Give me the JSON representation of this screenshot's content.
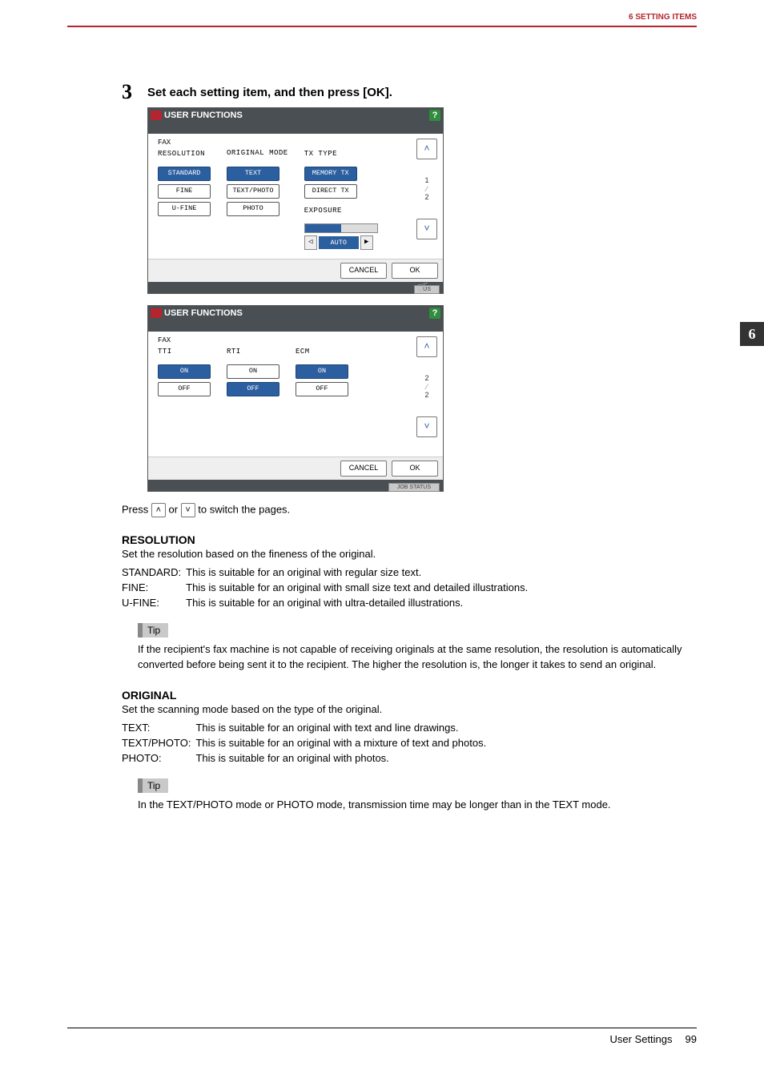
{
  "header": {
    "section": "6 SETTING ITEMS"
  },
  "side_tab": "6",
  "step": {
    "number": "3",
    "text": "Set each setting item, and then press [OK]."
  },
  "panel_title": "USER FUNCTIONS",
  "fax_label": "FAX",
  "screen1": {
    "col1": {
      "title": "RESOLUTION",
      "options": [
        "STANDARD",
        "FINE",
        "U-FINE"
      ],
      "selected": 0
    },
    "col2": {
      "title": "ORIGINAL MODE",
      "options": [
        "TEXT",
        "TEXT/PHOTO",
        "PHOTO"
      ],
      "selected": 0
    },
    "col3": {
      "title": "TX TYPE",
      "options": [
        "MEMORY TX",
        "DIRECT TX"
      ],
      "selected": 0
    },
    "exposure": {
      "label": "EXPOSURE",
      "auto": "AUTO"
    },
    "page": {
      "cur": "1",
      "total": "2"
    },
    "status_suffix": "US"
  },
  "screen2": {
    "col1": {
      "title": "TTI",
      "options": [
        "ON",
        "OFF"
      ],
      "selected": 0
    },
    "col2": {
      "title": "RTI",
      "options": [
        "ON",
        "OFF"
      ],
      "selected": 1
    },
    "col3": {
      "title": "ECM",
      "options": [
        "ON",
        "OFF"
      ],
      "selected": 0
    },
    "page": {
      "cur": "2",
      "total": "2"
    },
    "status_suffix": "JOB STATUS"
  },
  "buttons": {
    "cancel": "CANCEL",
    "ok": "OK"
  },
  "switch_note": {
    "pre": "Press ",
    "mid": " or ",
    "post": " to switch the pages."
  },
  "resolution": {
    "heading": "RESOLUTION",
    "desc": "Set the resolution based on the fineness of the original.",
    "rows": [
      {
        "k": "STANDARD:",
        "v": "This is suitable for an original with regular size text."
      },
      {
        "k": "FINE:",
        "v": "This is suitable for an original with small size text and detailed illustrations."
      },
      {
        "k": "U-FINE:",
        "v": "This is suitable for an original with ultra-detailed illustrations."
      }
    ],
    "tip": "If the recipient's fax machine is not capable of receiving originals at the same resolution, the resolution is automatically converted before being sent it to the recipient. The higher the resolution is, the longer it takes to send an original."
  },
  "original": {
    "heading": "ORIGINAL",
    "desc": "Set the scanning mode based on the type of the original.",
    "rows": [
      {
        "k": "TEXT:",
        "v": "This is suitable for an original with text and line drawings."
      },
      {
        "k": "TEXT/PHOTO:",
        "v": "This is suitable for an original with a mixture of text and photos."
      },
      {
        "k": "PHOTO:",
        "v": "This is suitable for an original with photos."
      }
    ],
    "tip": "In the TEXT/PHOTO mode or PHOTO mode, transmission time may be longer than in the TEXT mode."
  },
  "tip_label": "Tip",
  "footer": {
    "title": "User Settings",
    "page": "99"
  }
}
